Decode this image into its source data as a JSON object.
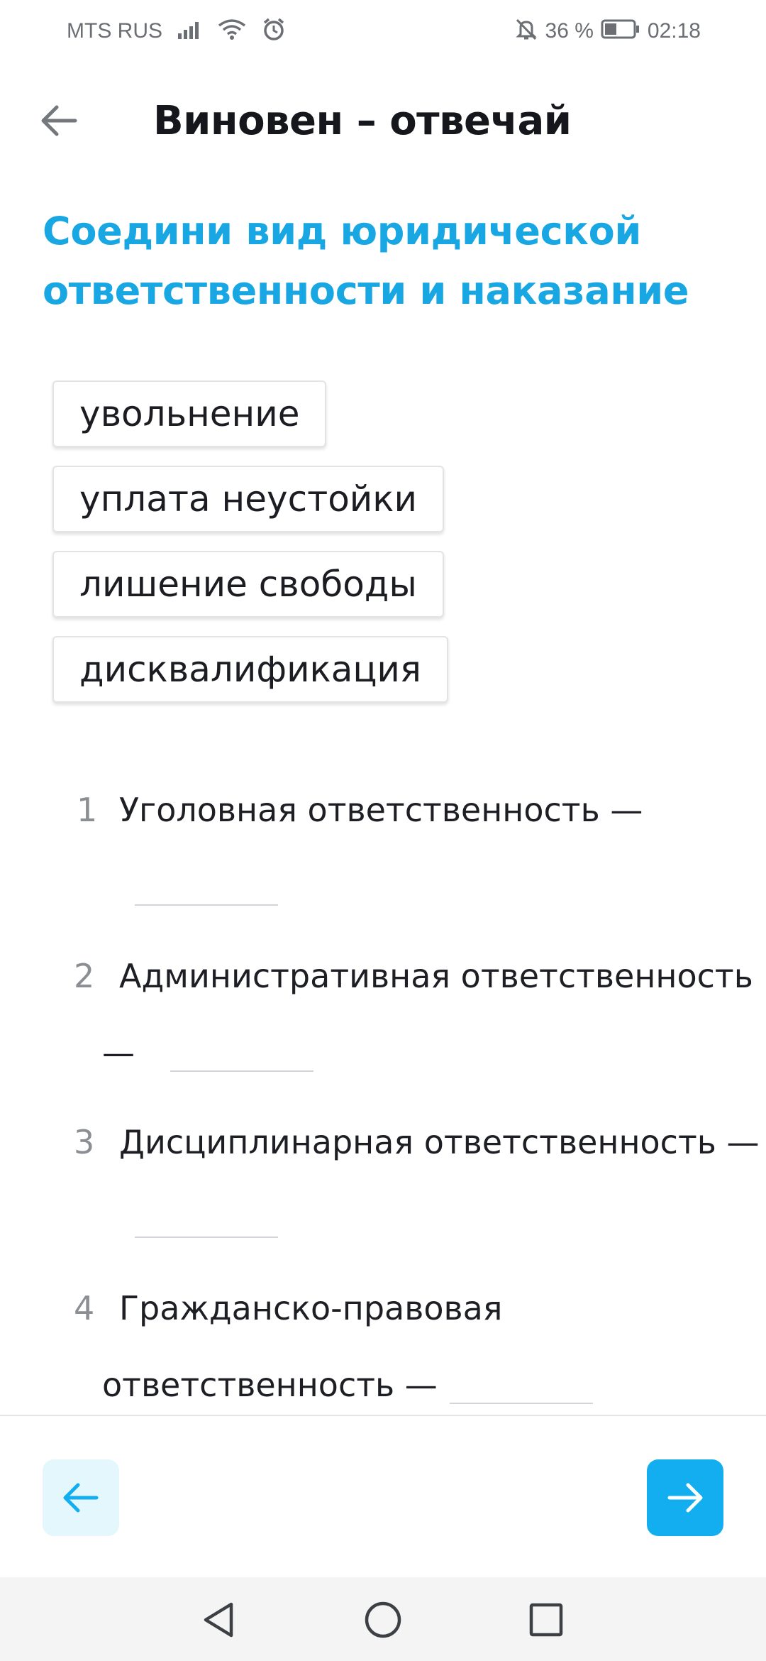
{
  "status_bar": {
    "carrier": "MTS RUS",
    "battery": "36 %",
    "time": "02:18",
    "icons": [
      "signal-icon",
      "wifi-icon",
      "alarm-icon",
      "mute-bell-icon",
      "battery-icon"
    ]
  },
  "header": {
    "title": "Виновен – отвечай",
    "back_icon": "arrow-left-icon"
  },
  "task": {
    "title": "Соедини вид юридической ответственности и наказание"
  },
  "options": [
    {
      "label": "увольнение"
    },
    {
      "label": "уплата неустойки"
    },
    {
      "label": "лишение свободы"
    },
    {
      "label": "дисквалификация"
    }
  ],
  "questions": [
    {
      "number": "1",
      "text": "Уголовная ответственность —"
    },
    {
      "number": "2",
      "text_line1": "Административная ответственность",
      "text_line2": "—"
    },
    {
      "number": "3",
      "text": "Дисциплинарная ответственность —"
    },
    {
      "number": "4",
      "text_line1": "Гражданско-правовая",
      "text_line2": "ответственность —"
    }
  ],
  "navigation": {
    "prev_icon": "arrow-left-icon",
    "next_icon": "arrow-right-icon"
  },
  "system_nav": {
    "icons": [
      "back-triangle-icon",
      "home-circle-icon",
      "recents-square-icon"
    ]
  },
  "colors": {
    "accent": "#13aef0",
    "heading": "#19a7e3",
    "prev_button_bg": "#e3f7fd"
  }
}
